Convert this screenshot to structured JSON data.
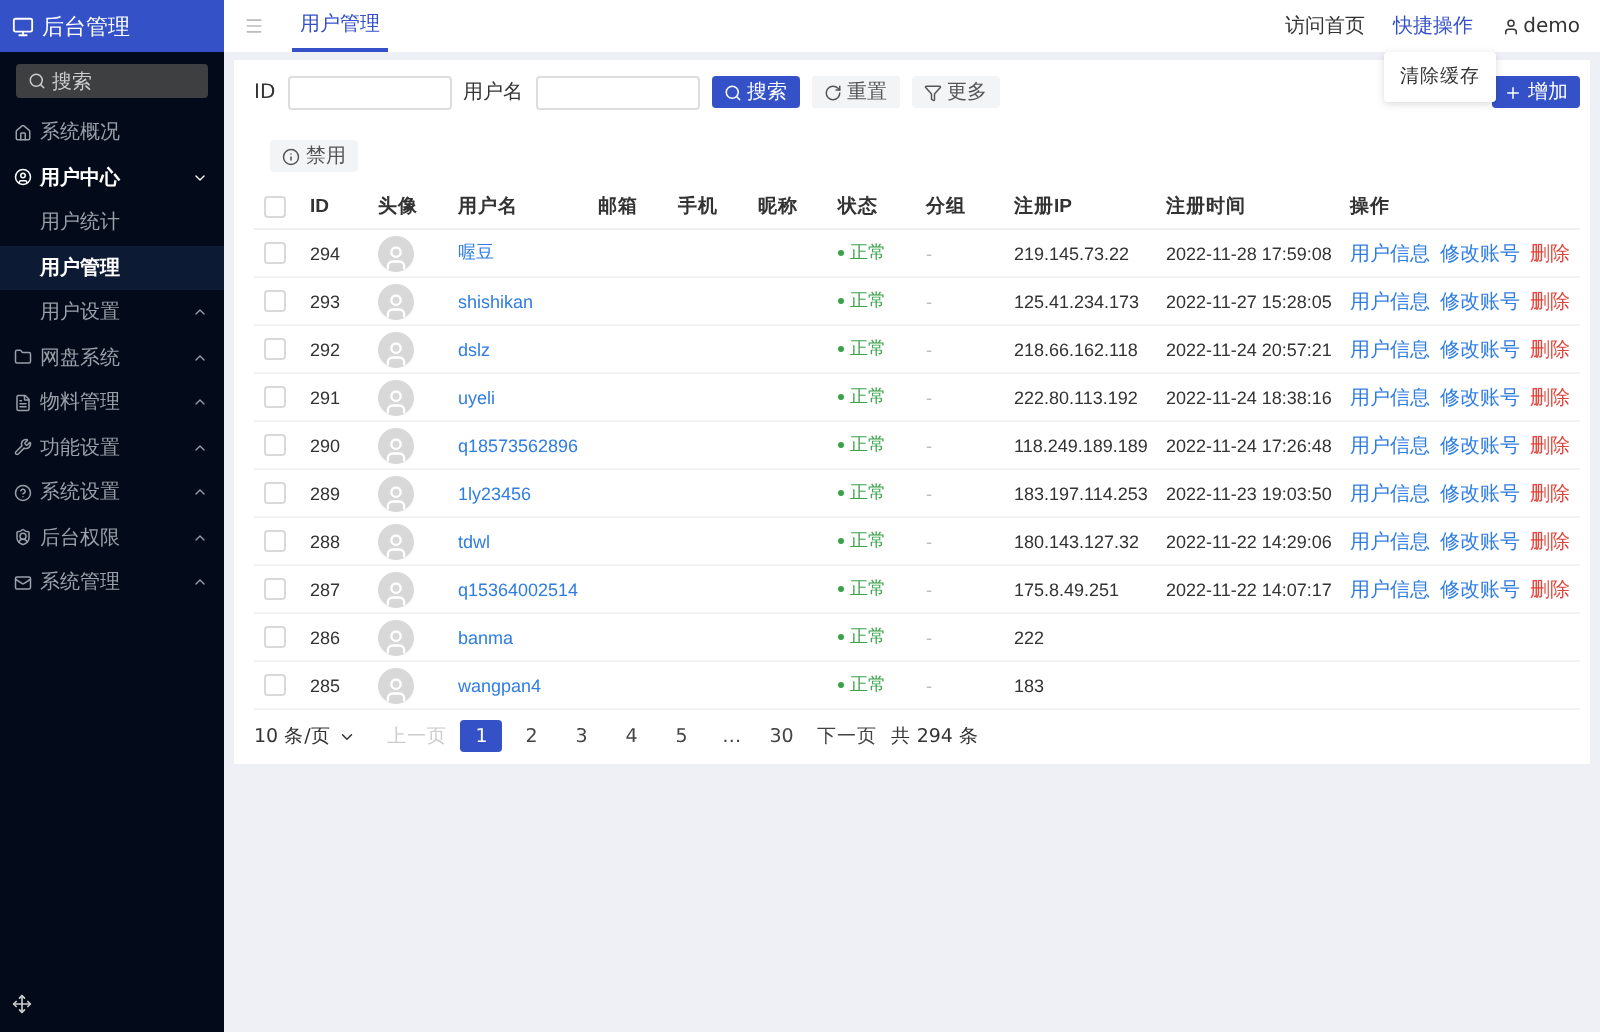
{
  "sidebar": {
    "title": "后台管理",
    "search_placeholder": "搜索",
    "items": [
      {
        "label": "系统概况",
        "selected": false
      },
      {
        "label": "用户中心",
        "selected": false,
        "expanded": true,
        "children": [
          {
            "label": "用户统计",
            "selected": false
          },
          {
            "label": "用户管理",
            "selected": true
          },
          {
            "label": "用户设置",
            "selected": false,
            "expanded": false
          }
        ]
      },
      {
        "label": "网盘系统",
        "selected": false,
        "expanded": false
      },
      {
        "label": "物料管理",
        "selected": false,
        "expanded": false
      },
      {
        "label": "功能设置",
        "selected": false,
        "expanded": false
      },
      {
        "label": "系统设置",
        "selected": false,
        "expanded": false
      },
      {
        "label": "后台权限",
        "selected": false,
        "expanded": false
      },
      {
        "label": "系统管理",
        "selected": false,
        "expanded": false
      }
    ]
  },
  "topbar": {
    "tabs": [
      {
        "label": "用户管理",
        "selected": true
      }
    ],
    "links": [
      {
        "label": "访问首页",
        "selected": false
      },
      {
        "label": "快捷操作",
        "selected": true
      },
      {
        "label": "demo",
        "selected": false,
        "kind": "user"
      }
    ],
    "dropdown": [
      "清除缓存"
    ]
  },
  "filters": [
    {
      "label": "ID"
    },
    {
      "label": "用户名"
    }
  ],
  "buttons": [
    {
      "label": "搜索",
      "kind": "primary"
    },
    {
      "label": "重置",
      "kind": "reset"
    },
    {
      "label": "更多",
      "kind": "filter"
    }
  ],
  "add_button": "增加",
  "bulk_button": "禁用",
  "table": {
    "header_checked": false,
    "columns": [
      "ID",
      "头像",
      "用户名",
      "邮箱",
      "手机",
      "昵称",
      "状态",
      "分组",
      "注册IP",
      "注册时间",
      "操作"
    ],
    "rows": [
      {
        "checked": false,
        "id": "294",
        "username": "喔豆",
        "status": "正常",
        "group": "-",
        "ip": "219.145.73.22",
        "time": "2022-11-28 17:59:08",
        "actions": [
          {
            "label": "用户信息",
            "kind": "link"
          },
          {
            "label": "修改账号",
            "kind": "link"
          },
          {
            "label": "删除",
            "kind": "danger"
          }
        ]
      },
      {
        "checked": false,
        "id": "293",
        "username": "shishikan",
        "status": "正常",
        "group": "-",
        "ip": "125.41.234.173",
        "time": "2022-11-27 15:28:05",
        "actions": [
          {
            "label": "用户信息",
            "kind": "link"
          },
          {
            "label": "修改账号",
            "kind": "link"
          },
          {
            "label": "删除",
            "kind": "danger"
          }
        ]
      },
      {
        "checked": false,
        "id": "292",
        "username": "dslz",
        "status": "正常",
        "group": "-",
        "ip": "218.66.162.118",
        "time": "2022-11-24 20:57:21",
        "actions": [
          {
            "label": "用户信息",
            "kind": "link"
          },
          {
            "label": "修改账号",
            "kind": "link"
          },
          {
            "label": "删除",
            "kind": "danger"
          }
        ]
      },
      {
        "checked": false,
        "id": "291",
        "username": "uyeli",
        "status": "正常",
        "group": "-",
        "ip": "222.80.113.192",
        "time": "2022-11-24 18:38:16",
        "actions": [
          {
            "label": "用户信息",
            "kind": "link"
          },
          {
            "label": "修改账号",
            "kind": "link"
          },
          {
            "label": "删除",
            "kind": "danger"
          }
        ]
      },
      {
        "checked": false,
        "id": "290",
        "username": "q18573562896",
        "status": "正常",
        "group": "-",
        "ip": "118.249.189.189",
        "time": "2022-11-24 17:26:48",
        "actions": [
          {
            "label": "用户信息",
            "kind": "link"
          },
          {
            "label": "修改账号",
            "kind": "link"
          },
          {
            "label": "删除",
            "kind": "danger"
          }
        ]
      },
      {
        "checked": false,
        "id": "289",
        "username": "1ly23456",
        "status": "正常",
        "group": "-",
        "ip": "183.197.114.253",
        "time": "2022-11-23 19:03:50",
        "actions": [
          {
            "label": "用户信息",
            "kind": "link"
          },
          {
            "label": "修改账号",
            "kind": "link"
          },
          {
            "label": "删除",
            "kind": "danger"
          }
        ]
      },
      {
        "checked": false,
        "id": "288",
        "username": "tdwl",
        "status": "正常",
        "group": "-",
        "ip": "180.143.127.32",
        "time": "2022-11-22 14:29:06",
        "actions": [
          {
            "label": "用户信息",
            "kind": "link"
          },
          {
            "label": "修改账号",
            "kind": "link"
          },
          {
            "label": "删除",
            "kind": "danger"
          }
        ]
      },
      {
        "checked": false,
        "id": "287",
        "username": "q15364002514",
        "status": "正常",
        "group": "-",
        "ip": "175.8.49.251",
        "time": "2022-11-22 14:07:17",
        "actions": [
          {
            "label": "用户信息",
            "kind": "link"
          },
          {
            "label": "修改账号",
            "kind": "link"
          },
          {
            "label": "删除",
            "kind": "danger"
          }
        ]
      },
      {
        "checked": false,
        "id": "286",
        "username": "banma",
        "status": "正常",
        "group": "-",
        "ip": "222"
      },
      {
        "checked": false,
        "id": "285",
        "username": "wangpan4",
        "status": "正常",
        "group": "-",
        "ip": "183"
      }
    ]
  },
  "pagination": {
    "page_size": "10 条/页",
    "prev": {
      "label": "上一页",
      "disabled": true
    },
    "pages": [
      {
        "label": "1",
        "selected": true
      },
      {
        "label": "2",
        "selected": false
      },
      {
        "label": "3",
        "selected": false
      },
      {
        "label": "4",
        "selected": false
      },
      {
        "label": "5",
        "selected": false
      },
      {
        "label": "…",
        "selected": false
      },
      {
        "label": "30",
        "selected": false
      }
    ],
    "next": {
      "label": "下一页",
      "disabled": false
    },
    "total": "共 294 条"
  }
}
